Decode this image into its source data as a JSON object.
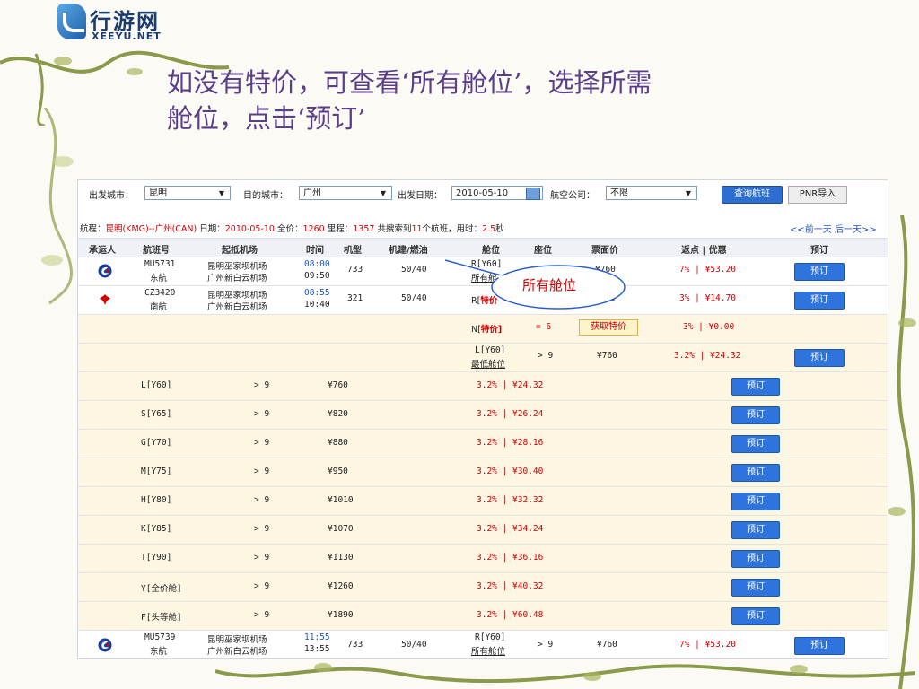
{
  "logo": {
    "cn": "行游网",
    "en": "XEEYU.NET"
  },
  "slide_title": {
    "line1": "如没有特价，可查看‘所有舱位’，选择所需",
    "line2": "舱位，点击‘预订’"
  },
  "search": {
    "from_label": "出发城市：",
    "from_value": "昆明",
    "to_label": "目的城市：",
    "to_value": "广州",
    "date_label": "出发日期：",
    "date_value": "2010-05-10",
    "airline_label": "航空公司：",
    "airline_value": "不限",
    "search_button": "查询航班",
    "pnr_button": "PNR导入"
  },
  "info": {
    "p1": "航程：",
    "route": "昆明(KMG)--广州(CAN)",
    "p2": " 日期：",
    "date": "2010-05-10",
    "p3": " 全价：",
    "full_price": "1260",
    "p4": " 里程：",
    "mileage": "1357",
    "p5": " 共搜索到",
    "count": "11",
    "p6": "个航班，用时：",
    "time": "2.5",
    "p7": "秒",
    "nav": "<<前一天 后一天>>"
  },
  "headers": [
    "承运人",
    "航班号",
    "起抵机场",
    "时间",
    "机型",
    "机建/燃油",
    "舱位",
    "座位",
    "票面价",
    "返点 | 优惠",
    "预订"
  ],
  "book_label": "预订",
  "flights": [
    {
      "flight_no": "MU5731",
      "airline": "东航",
      "dep_airport": "昆明巫家坝机场",
      "arr_airport": "广州新白云机场",
      "dep_time": "08:00",
      "arr_time": "09:50",
      "aircraft": "733",
      "tax": "50/40",
      "cabin": "R[Y60]",
      "cabin_link": "所有舱",
      "price": "¥760",
      "rebate": "7% | ¥53.20"
    },
    {
      "flight_no": "CZ3420",
      "airline": "南航",
      "dep_airport": "昆明巫家坝机场",
      "arr_airport": "广州新白云机场",
      "dep_time": "08:55",
      "arr_time": "10:40",
      "aircraft": "321",
      "tax": "50/40",
      "cabin_prefix": "R[",
      "cabin_special": "特价",
      "price": "¥760",
      "rebate": "3% | ¥14.70"
    }
  ],
  "special_row": {
    "cabin_prefix": "N[",
    "cabin_special": "特价",
    "cabin_suffix": "]",
    "seats": "= 6",
    "get_price": "获取特价",
    "rebate": "3% | ¥0.00"
  },
  "lowest_row": {
    "cabin": "L[Y60]",
    "cabin_link": "最低舱位",
    "seats": "> 9",
    "price": "¥760",
    "rebate": "3.2% | ¥24.32"
  },
  "cabins": [
    {
      "cabin": "L[Y60]",
      "seats": "> 9",
      "price": "¥760",
      "rebate": "3.2% | ¥24.32"
    },
    {
      "cabin": "S[Y65]",
      "seats": "> 9",
      "price": "¥820",
      "rebate": "3.2% | ¥26.24"
    },
    {
      "cabin": "G[Y70]",
      "seats": "> 9",
      "price": "¥880",
      "rebate": "3.2% | ¥28.16"
    },
    {
      "cabin": "M[Y75]",
      "seats": "> 9",
      "price": "¥950",
      "rebate": "3.2% | ¥30.40"
    },
    {
      "cabin": "H[Y80]",
      "seats": "> 9",
      "price": "¥1010",
      "rebate": "3.2% | ¥32.32"
    },
    {
      "cabin": "K[Y85]",
      "seats": "> 9",
      "price": "¥1070",
      "rebate": "3.2% | ¥34.24"
    },
    {
      "cabin": "T[Y90]",
      "seats": "> 9",
      "price": "¥1130",
      "rebate": "3.2% | ¥36.16"
    },
    {
      "cabin": "Y[全价舱]",
      "seats": "> 9",
      "price": "¥1260",
      "rebate": "3.2% | ¥40.32"
    },
    {
      "cabin": "F[头等舱]",
      "seats": "> 9",
      "price": "¥1890",
      "rebate": "3.2% | ¥60.48"
    }
  ],
  "last_flight": {
    "flight_no": "MU5739",
    "airline": "东航",
    "dep_airport": "昆明巫家坝机场",
    "arr_airport": "广州新白云机场",
    "dep_time": "11:55",
    "arr_time": "13:55",
    "aircraft": "733",
    "tax": "50/40",
    "cabin": "R[Y60]",
    "cabin_link": "所有舱位",
    "seats": "> 9",
    "price": "¥760",
    "rebate": "7% | ¥53.20"
  },
  "callout": {
    "text": "所有舱位"
  },
  "colors": {
    "title": "#5a3e8a",
    "accent_red": "#d40000",
    "button_blue": "#2f74dc",
    "vine": "#8a9a4a"
  }
}
